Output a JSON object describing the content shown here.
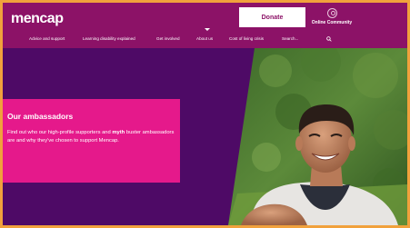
{
  "header": {
    "logo": "mencap",
    "donate_label": "Donate",
    "community_label": "Online Community"
  },
  "nav": {
    "items": [
      {
        "label": "Advice and support"
      },
      {
        "label": "Learning disability explained"
      },
      {
        "label": "Get involved"
      },
      {
        "label": "About us"
      },
      {
        "label": "Cost of living crisis"
      },
      {
        "label": "Search..."
      }
    ]
  },
  "hero": {
    "title": "Our ambassadors",
    "text_before": "Find out who our high-profile supporters and",
    "text_bold": "myth",
    "text_after": "buster ambassadors are and why they've chosen to support Mencap."
  },
  "colors": {
    "header_bg": "#8c1267",
    "hero_bg": "#4e0a66",
    "card_bg": "#e5198b",
    "page_border": "#f1a13c"
  },
  "icons": [
    "user-circle-icon",
    "search-icon",
    "caret-down-icon"
  ]
}
